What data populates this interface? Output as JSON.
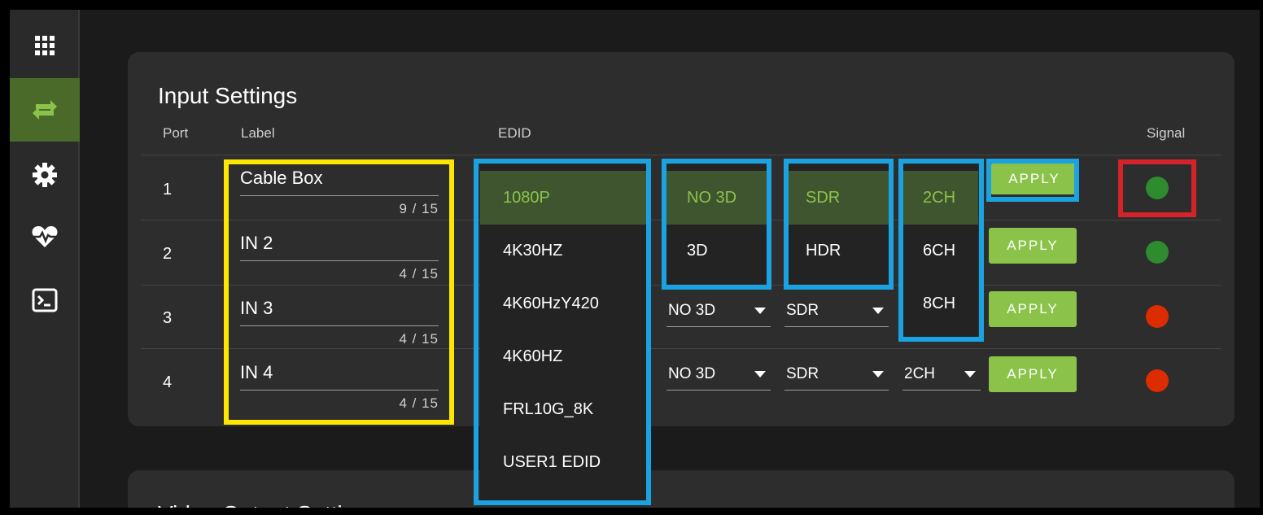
{
  "sidebar": {
    "items": [
      {
        "name": "apps-grid-icon"
      },
      {
        "name": "swap-arrows-icon"
      },
      {
        "name": "gear-icon"
      },
      {
        "name": "heart-pulse-icon"
      },
      {
        "name": "terminal-icon"
      }
    ]
  },
  "input_settings": {
    "title": "Input Settings",
    "headers": {
      "port": "Port",
      "label": "Label",
      "edid": "EDID",
      "signal": "Signal"
    },
    "rows": [
      {
        "port": "1",
        "label": "Cable Box",
        "count": "9 / 15",
        "signal": "green"
      },
      {
        "port": "2",
        "label": "IN 2",
        "count": "4 / 15",
        "signal": "green"
      },
      {
        "port": "3",
        "label": "IN 3",
        "count": "4 / 15",
        "signal": "red",
        "three_d": "NO 3D",
        "hdr": "SDR"
      },
      {
        "port": "4",
        "label": "IN 4",
        "count": "4 / 15",
        "signal": "red",
        "three_d": "NO 3D",
        "hdr": "SDR",
        "audio": "2CH"
      }
    ],
    "apply_label": "APPLY"
  },
  "dropdowns": {
    "edid": {
      "options": [
        "1080P",
        "4K30HZ",
        "4K60HzY420",
        "4K60HZ",
        "FRL10G_8K",
        "USER1 EDID"
      ],
      "selected": "1080P"
    },
    "three_d": {
      "options": [
        "NO 3D",
        "3D"
      ],
      "selected": "NO 3D"
    },
    "hdr": {
      "options": [
        "SDR",
        "HDR"
      ],
      "selected": "SDR"
    },
    "audio": {
      "options": [
        "2CH",
        "6CH",
        "8CH"
      ],
      "selected": "2CH"
    }
  },
  "output_settings": {
    "title": "Video Output Settings"
  },
  "colors": {
    "accent": "#8bc34a",
    "signal_green": "#2e8b2e",
    "signal_red": "#dd2c00",
    "highlight_yellow": "#ffe600",
    "highlight_blue": "#1aa3e0",
    "highlight_red": "#d6232a"
  }
}
